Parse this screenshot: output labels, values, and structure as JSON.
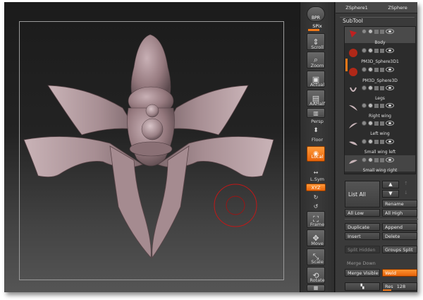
{
  "toolbar": {
    "bpr_label": "BPR",
    "spix_label": "SPix",
    "scroll_label": "Scroll",
    "zoom_label": "Zoom",
    "actual_label": "Actual",
    "aahalf_label": "AAHalf",
    "persp_label": "Persp",
    "floor_label": "Floor",
    "local_label": "Local",
    "lsym_label": "L.Sym",
    "xyz_label": "XYZ",
    "frame_label": "Frame",
    "move_label": "Move",
    "scale_label": "Scale",
    "rotate_label": "Rotate"
  },
  "panel": {
    "tabs": [
      "ZSphere1",
      "ZSphere"
    ],
    "subtool_header": "SubTool",
    "subtools": [
      "Body",
      "PM3D_Sphere3D1",
      "PM3D_Sphere3D",
      "Legs",
      "Right wing",
      "Left wing",
      "Small wing left",
      "Small wing right"
    ],
    "list_all": "List All",
    "rename": "Rename",
    "all_low": "All Low",
    "all_high": "All High",
    "duplicate": "Duplicate",
    "append": "Append",
    "insert": "Insert",
    "delete": "Delete",
    "split_hidden": "Split Hidden",
    "groups_split": "Groups Split",
    "merge_down": "Merge Down",
    "merge_visible": "Merge Visible",
    "weld": "Weld",
    "res_label": "Res",
    "res_value": "128"
  },
  "colors": {
    "accent": "#f07818",
    "model": "#b89ea3",
    "brush_ring": "#c01818"
  }
}
